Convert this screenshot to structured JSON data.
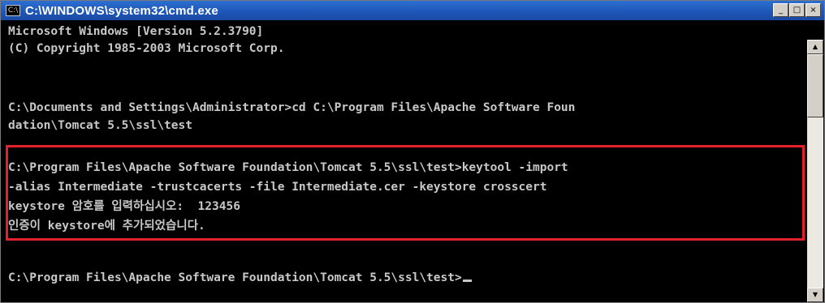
{
  "window": {
    "title": "C:\\WINDOWS\\system32\\cmd.exe",
    "icon": "cmd-prompt-icon",
    "controls": {
      "minimize": "_",
      "maximize": "□",
      "close": "×"
    }
  },
  "console": {
    "lines": [
      "Microsoft Windows [Version 5.2.3790]",
      "(C) Copyright 1985-2003 Microsoft Corp.",
      "",
      "C:\\Documents and Settings\\Administrator>cd C:\\Program Files\\Apache Software Foun",
      "dation\\Tomcat 5.5\\ssl\\test",
      "",
      "C:\\Program Files\\Apache Software Foundation\\Tomcat 5.5\\ssl\\test>keytool -import",
      "-alias Intermediate -trustcacerts -file Intermediate.cer -keystore crosscert",
      "keystore 암호를 입력하십시오:  123456",
      "인증이 keystore에 추가되었습니다.",
      "",
      "C:\\Program Files\\Apache Software Foundation\\Tomcat 5.5\\ssl\\test>"
    ]
  },
  "colors": {
    "titlebar": "#1f57b8",
    "console_bg": "#000000",
    "console_text": "#c8c8c8",
    "highlight_border": "#e4202a"
  }
}
